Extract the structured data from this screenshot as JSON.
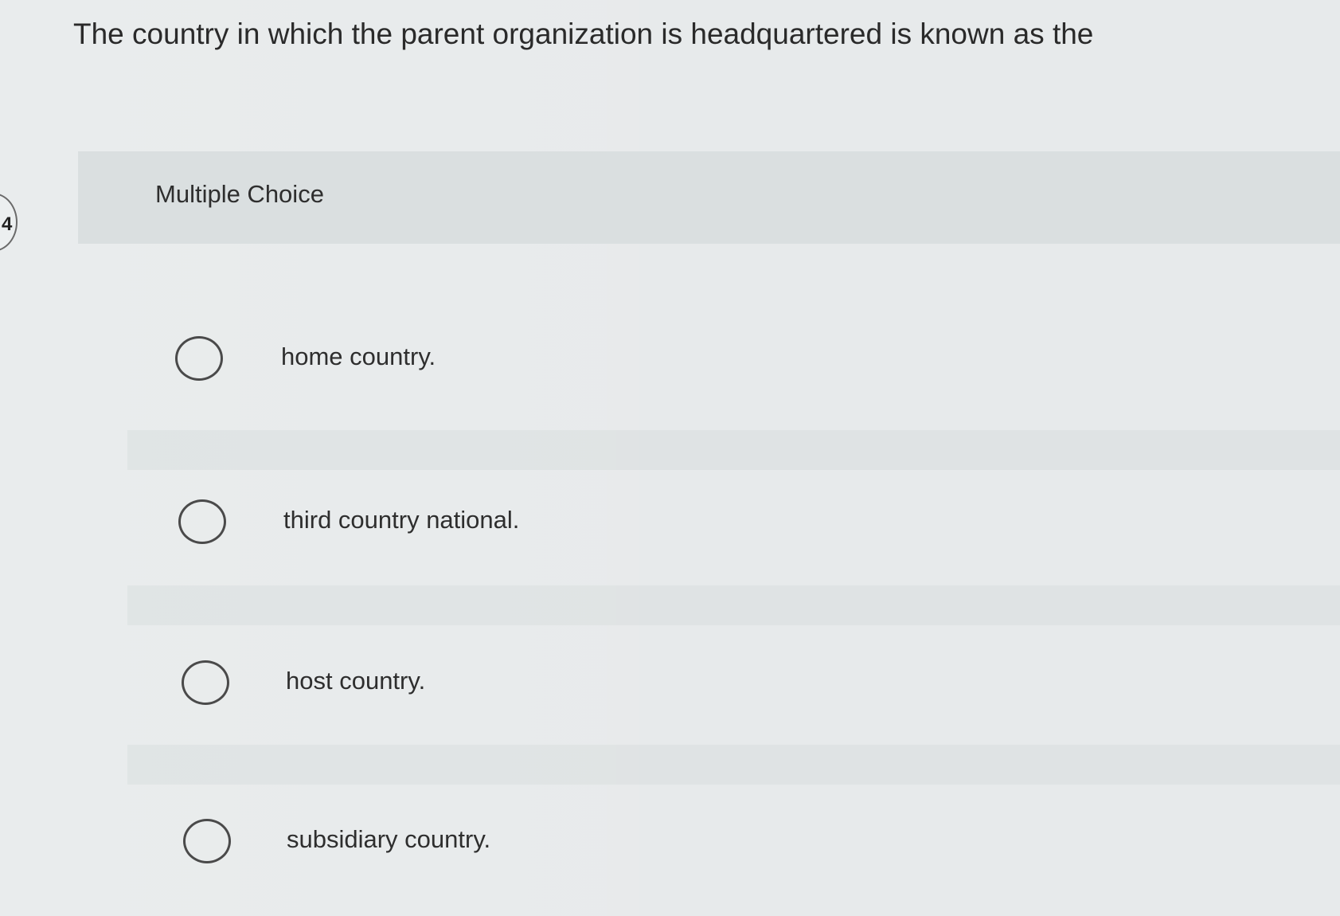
{
  "question": {
    "number": "4",
    "text": "The country in which the parent organization is headquartered is known as the"
  },
  "section": {
    "label": "Multiple Choice"
  },
  "options": [
    {
      "label": "home country."
    },
    {
      "label": "third country national."
    },
    {
      "label": "host country."
    },
    {
      "label": "subsidiary country."
    }
  ]
}
